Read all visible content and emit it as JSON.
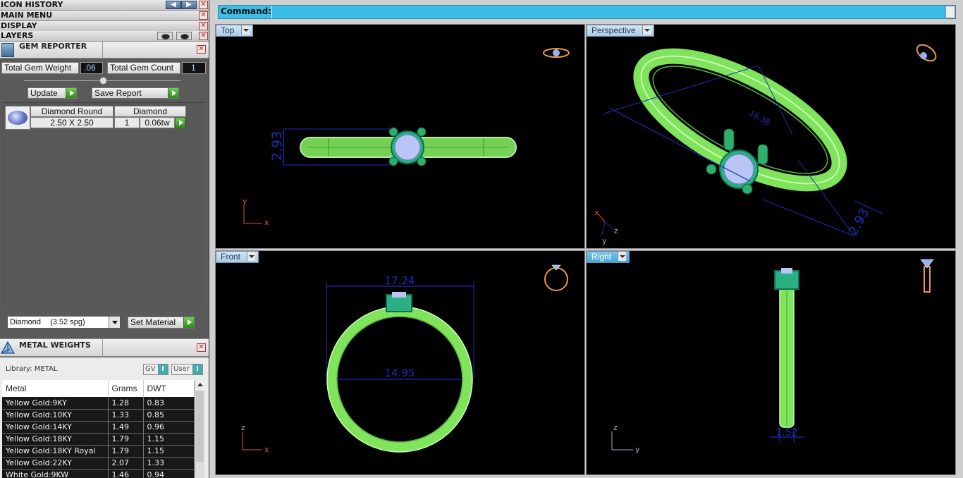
{
  "left_panel": {
    "icon_history": "ICON HISTORY",
    "main_menu": "MAIN MENU",
    "display": "DISPLAY",
    "layers": "LAYERS",
    "gem_reporter": {
      "title": "GEM REPORTER",
      "total_weight_label": "Total Gem Weight",
      "total_weight_value": ".06",
      "total_count_label": "Total Gem Count",
      "total_count_value": "1",
      "update_label": "Update",
      "save_report_label": "Save Report",
      "gem": {
        "shape_header": "Diamond Round",
        "material_header": "Diamond",
        "size": "2.50 X 2.50",
        "count": "1",
        "weight": "0.06tw"
      }
    },
    "material_select": {
      "name": "Diamond",
      "spg": "(3.52 spg)"
    },
    "set_material_label": "Set Material",
    "metal_weights": {
      "title": "METAL WEIGHTS",
      "library_label": "Library: METAL",
      "gv_label": "GV",
      "user_label": "User",
      "columns": [
        "Metal",
        "Grams",
        "DWT"
      ],
      "rows": [
        {
          "metal": "Yellow Gold:9KY",
          "grams": "1.28",
          "dwt": "0.83"
        },
        {
          "metal": "Yellow Gold:10KY",
          "grams": "1.33",
          "dwt": "0.85"
        },
        {
          "metal": "Yellow Gold:14KY",
          "grams": "1.49",
          "dwt": "0.96"
        },
        {
          "metal": "Yellow Gold:18KY",
          "grams": "1.79",
          "dwt": "1.15"
        },
        {
          "metal": "Yellow Gold:18KY Royal",
          "grams": "1.79",
          "dwt": "1.15"
        },
        {
          "metal": "Yellow Gold:22KY",
          "grams": "2.07",
          "dwt": "1.33"
        },
        {
          "metal": "White Gold:9KW",
          "grams": "1.46",
          "dwt": "0.94"
        }
      ]
    }
  },
  "command": {
    "label": "Command:",
    "value": ""
  },
  "viewports": {
    "top": {
      "label": "Top",
      "dim_height": "2.93",
      "axis_x": "x",
      "axis_y": "y"
    },
    "perspective": {
      "label": "Perspective",
      "dim_a": "16.38",
      "dim_b": "2.93",
      "axis_x": "x",
      "axis_y": "y",
      "axis_z": "z"
    },
    "front": {
      "label": "Front",
      "dim_outer": "17.24",
      "dim_inner": "14.95",
      "axis_x": "x",
      "axis_z": "z"
    },
    "right": {
      "label": "Right",
      "dim_width": "1.52",
      "axis_y": "y",
      "axis_z": "z"
    }
  },
  "colors": {
    "metal_green": "#8af06a",
    "gem_blue": "#b9c6f5",
    "dimension_blue": "#1a2fb5",
    "command_bar": "#3cbde6",
    "thumbnail_orange": "#e89a4a"
  }
}
